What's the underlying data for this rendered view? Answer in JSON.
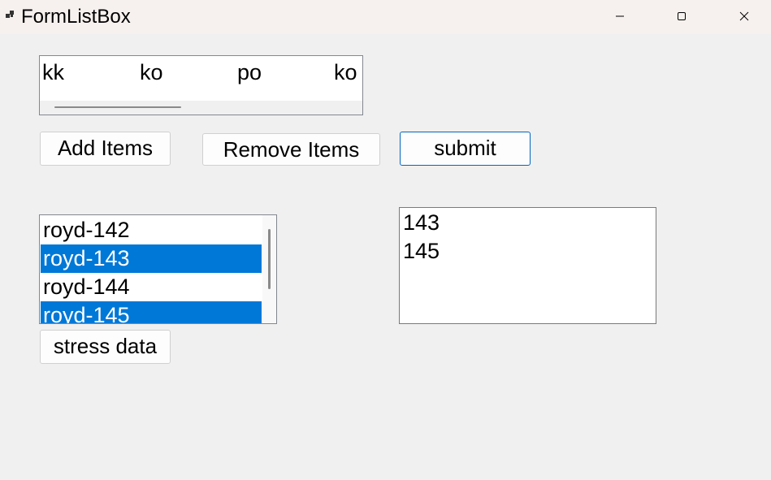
{
  "window": {
    "title": "FormListBox",
    "icon": "app-icon",
    "controls": {
      "minimize_icon": "minimize-icon",
      "maximize_icon": "maximize-icon",
      "close_icon": "close-icon"
    }
  },
  "multicolumn_list": {
    "items": [
      "kk",
      "ko",
      "po",
      "ko"
    ]
  },
  "buttons": {
    "add_items": "Add Items",
    "remove_items": "Remove Items",
    "submit": "submit",
    "stress_data": "stress data"
  },
  "list": {
    "items": [
      {
        "label": "royd-142",
        "selected": false
      },
      {
        "label": "royd-143",
        "selected": true
      },
      {
        "label": "royd-144",
        "selected": false
      },
      {
        "label": "royd-145",
        "selected": true
      }
    ]
  },
  "output": {
    "lines": [
      "143",
      "145"
    ]
  },
  "colors": {
    "selection": "#0078d7",
    "accent_border": "#0067c0",
    "background": "#f0f0f0"
  }
}
